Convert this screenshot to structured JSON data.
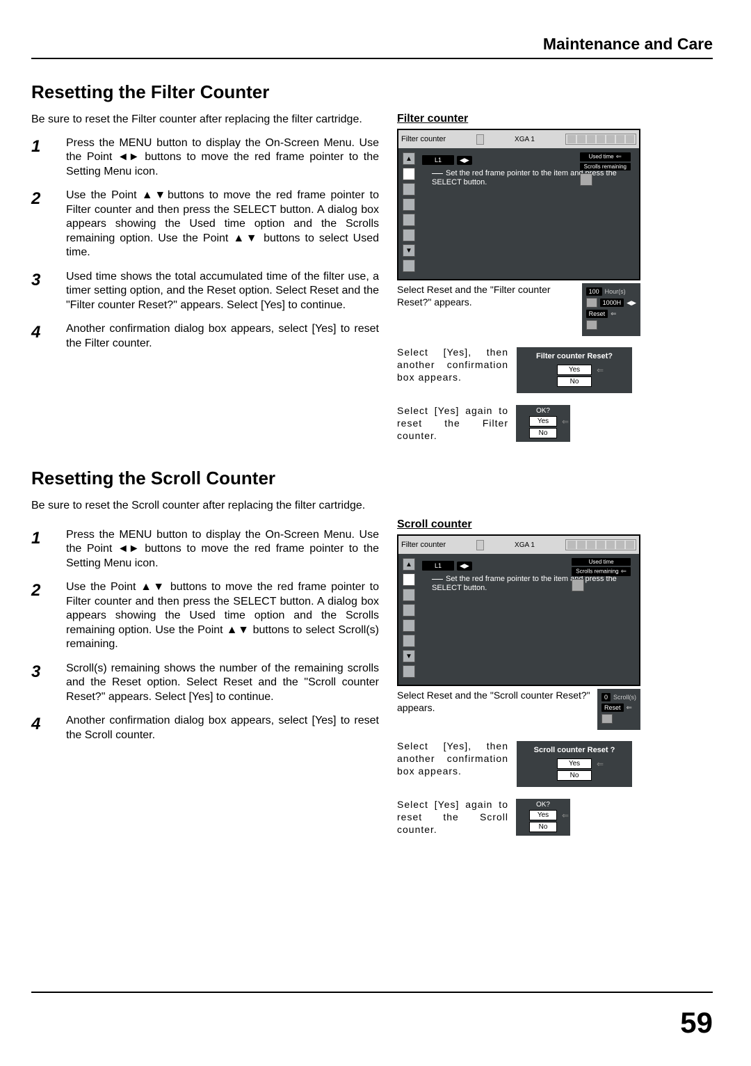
{
  "header": {
    "chapter": "Maintenance and Care"
  },
  "section1": {
    "title": "Resetting the Filter Counter",
    "intro": "Be sure to reset the Filter counter after replacing the filter cartridge.",
    "steps": [
      "Press the MENU button to display the On-Screen Menu. Use the Point ◄► buttons to move the red frame pointer to the Setting Menu icon.",
      "Use the Point ▲▼buttons to move the red frame pointer to Filter counter and then press the SELECT button. A dialog box appears showing the Used time option and the Scrolls remaining option. Use the Point ▲▼ buttons to select  Used time.",
      "Used time shows the total accumulated time of the filter use, a timer setting option, and the Reset option. Select Reset and the \"Filter counter Reset?\" appears. Select [Yes] to continue.",
      "Another confirmation dialog box appears, select [Yes] to reset the Filter counter."
    ],
    "figure_title": "Filter counter",
    "osd": {
      "title": "Filter counter",
      "mode": "XGA 1",
      "menu_item": "L1",
      "note": "Set the red frame pointer to the item and press the SELECT button.",
      "opt1": "Used time",
      "opt2": "Scrolls remaining",
      "val": "100",
      "unit": "Hour(s)",
      "setting": "1000H",
      "reset": "Reset"
    },
    "cap1": "Select Reset and the \"Filter counter Reset?\" appears.",
    "cap2": "Select [Yes], then another confirmation box appears.",
    "cap3": "Select [Yes] again to reset the Filter counter.",
    "dlg1": {
      "title": "Filter counter Reset?",
      "yes": "Yes",
      "no": "No"
    },
    "dlg2": {
      "title": "OK?",
      "yes": "Yes",
      "no": "No"
    }
  },
  "section2": {
    "title": "Resetting the Scroll Counter",
    "intro": "Be sure to reset the Scroll counter after replacing the filter cartridge.",
    "steps": [
      "Press the MENU button to display the On-Screen Menu. Use the Point ◄► buttons to move the red frame pointer to the Setting Menu icon.",
      "Use the Point ▲▼ buttons to move the red frame pointer to Filter counter and then press the SELECT button. A dialog box appears showing the Used time option and the Scrolls remaining option. Use the Point ▲▼ buttons to select  Scroll(s) remaining.",
      "Scroll(s) remaining shows the number of the remaining scrolls and the Reset option. Select Reset and the \"Scroll counter Reset?\" appears. Select [Yes] to continue.",
      "Another confirmation dialog box appears, select [Yes] to reset the Scroll counter."
    ],
    "figure_title": "Scroll counter",
    "osd": {
      "title": "Filter counter",
      "mode": "XGA 1",
      "menu_item": "L1",
      "note": "Set the red frame pointer to the item and press the SELECT button.",
      "opt1": "Used time",
      "opt2": "Scrolls remaining",
      "val": "0",
      "unit": "Scroll(s)",
      "reset": "Reset"
    },
    "cap1": "Select Reset and the \"Scroll counter Reset?\" appears.",
    "cap2": "Select [Yes], then another confirmation box appears.",
    "cap3": "Select [Yes] again to reset the Scroll counter.",
    "dlg1": {
      "title": "Scroll counter Reset ?",
      "yes": "Yes",
      "no": "No"
    },
    "dlg2": {
      "title": "OK?",
      "yes": "Yes",
      "no": "No"
    }
  },
  "page_number": "59"
}
